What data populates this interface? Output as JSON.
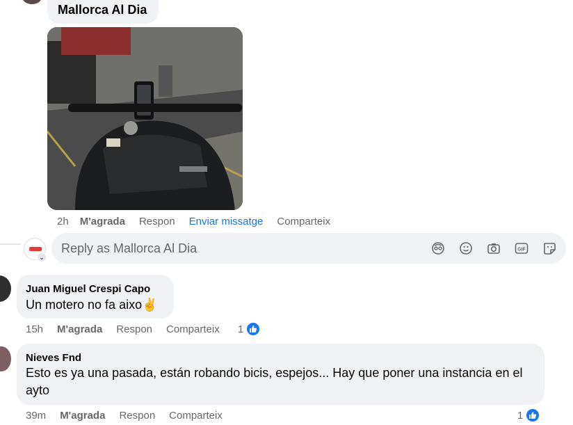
{
  "post": {
    "page_name": "Mallorca Al Dia",
    "time": "2h",
    "like_label": "M'agrada",
    "reply_label": "Respon",
    "message_label": "Enviar missatge",
    "share_label": "Comparteix"
  },
  "reply_box": {
    "placeholder": "Reply as Mallorca Al Dia",
    "tools": [
      "avatar-sticker-icon",
      "emoji-icon",
      "camera-icon",
      "gif-icon",
      "sticker-icon"
    ]
  },
  "comments": [
    {
      "author": "Juan Miguel Crespi Capo",
      "text": "Un motero no fa aixo",
      "emoji": "✌",
      "time": "15h",
      "like_label": "M'agrada",
      "reply_label": "Respon",
      "share_label": "Comparteix",
      "reactions": "1"
    },
    {
      "author": "Nieves Fnd",
      "text_line1": "Esto es ya una pasada, están robando bicis, espejos... Hay que poner una instancia en el",
      "text_line2": "ayto",
      "time": "39m",
      "like_label": "M'agrada",
      "reply_label": "Respon",
      "share_label": "Comparteix",
      "reactions": "1"
    }
  ],
  "colors": {
    "link_blue": "#1b74e4",
    "reaction_blue": "#1877f2",
    "bubble_gray": "#f0f2f5",
    "meta_gray": "#65676b"
  }
}
